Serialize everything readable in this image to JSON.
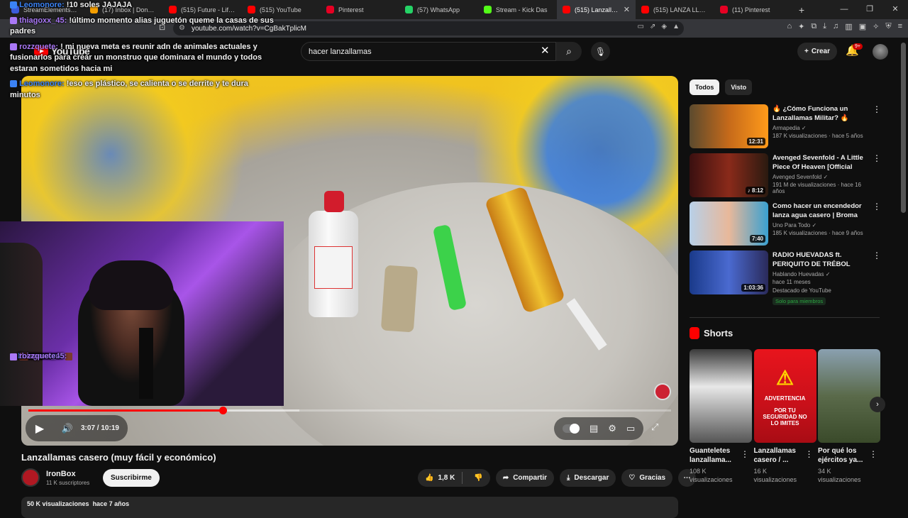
{
  "browser": {
    "tabs": [
      {
        "label": "StreamElements - My",
        "color": "#3b5bdb",
        "active": false
      },
      {
        "label": "(17) Inbox | Donoclip",
        "color": "#f59f00",
        "active": false
      },
      {
        "label": "(515) Future - Life Is",
        "color": "#ff0000",
        "active": false
      },
      {
        "label": "(515) YouTube",
        "color": "#ff0000",
        "active": false
      },
      {
        "label": "Pinterest",
        "color": "#e60023",
        "active": false
      },
      {
        "label": "(57) WhatsApp",
        "color": "#25d366",
        "active": false
      },
      {
        "label": "Stream - Kick Das",
        "color": "#53fc18",
        "active": false
      },
      {
        "label": "(515) Lanzallama",
        "color": "#ff0000",
        "active": true
      },
      {
        "label": "(515) LANZA LLAMA",
        "color": "#ff0000",
        "active": false
      },
      {
        "label": "(11) Pinterest",
        "color": "#e60023",
        "active": false
      }
    ],
    "url": "youtube.com/watch?v=CgBakTplicM"
  },
  "header": {
    "logo": "YouTube",
    "search_value": "hacer lanzallamas",
    "create_label": "Crear",
    "notif_count": "9+"
  },
  "chat": [
    {
      "user": "Leomonore:",
      "text": "",
      "user_color": "#3b83f6",
      "emote": false
    },
    {
      "user": "Leomonore:",
      "text": "!10 soles JAJAJA",
      "user_color": "#3b83f6",
      "emote": false
    },
    {
      "user": "Leomonore:",
      "text": "",
      "user_color": "#3b83f6",
      "emote": true
    },
    {
      "user": "",
      "text": "",
      "user_color": "#3b83f6",
      "emote": true
    },
    {
      "user": "Leomonore:",
      "text": "",
      "user_color": "#3b83f6",
      "emote": true
    },
    {
      "user": "Leomonore:",
      "text": "",
      "user_color": "#3b83f6",
      "emote": true
    },
    {
      "user": "thiagoxx_45:",
      "text": "!último momento alias juguetón queme la casas de sus padres",
      "user_color": "#a978f6",
      "emote": false
    },
    {
      "user": "thiagoxx_45:",
      "text": "",
      "user_color": "#a978f6",
      "emote": false
    },
    {
      "user": "rozzquete:",
      "text": "! mi nueva meta es reunir adn de animales actuales y fusionarlos para crear un monstruo que dominara el mundo y todos estaran sometidos hacia mi",
      "user_color": "#a978f6",
      "emote": false
    },
    {
      "user": "rozzquete:",
      "text": "",
      "user_color": "#a978f6",
      "emote": false
    },
    {
      "user": "Leomonore:",
      "text": "!eso es plástico, se calienta o se derrite y te dura minutos",
      "user_color": "#3b83f6",
      "emote": false
    }
  ],
  "player": {
    "current_time": "3:07",
    "duration": "10:19",
    "progress_fraction": 0.302
  },
  "video": {
    "title": "Lanzallamas casero (muy fácil y económico)",
    "channel": "IronBox",
    "subscribers": "11 K suscriptores",
    "subscribe_label": "Suscribirme",
    "likes": "1,8 K",
    "share_label": "Compartir",
    "download_label": "Descargar",
    "thanks_label": "Gracias",
    "views": "50 K visualizaciones",
    "age": "hace 7 años"
  },
  "sidebar": {
    "chips": [
      "Todos",
      "Visto"
    ],
    "recommendations": [
      {
        "title": "🔥 ¿Cómo Funciona un Lanzallamas Militar? 🔥",
        "channel": "Armapedia",
        "meta": "187 K visualizaciones · hace 5 años",
        "duration": "12:31",
        "thumb": "linear-gradient(90deg,#5b4a2e,#c66a1a 50%,#ff9a1a)",
        "featured": "",
        "members": ""
      },
      {
        "title": "Avenged Sevenfold - A Little Piece Of Heaven [Official Musi...",
        "channel": "Avenged Sevenfold",
        "meta": "191 M de visualizaciones · hace 16 años",
        "duration": "♪ 8:12",
        "thumb": "linear-gradient(90deg,#3a1010,#8a2a1a 50%,#2a1a10)",
        "featured": "",
        "members": ""
      },
      {
        "title": "Como hacer un encendedor lanza agua casero | Broma",
        "channel": "Uno Para Todo",
        "meta": "185 K visualizaciones · hace 9 años",
        "duration": "7:40",
        "thumb": "linear-gradient(90deg,#b8d0e8,#e8b89a 50%,#3aa0d0)",
        "featured": "",
        "members": ""
      },
      {
        "title": "RADIO HUEVADAS ft. PERIQUITO DE TRÉBOL CLAN",
        "channel": "Hablando Huevadas",
        "meta": "hace 11 meses",
        "duration": "1:03:36",
        "thumb": "linear-gradient(90deg,#1a3a8a,#4a6ad0 50%,#2a2a5a)",
        "featured": "Destacado de YouTube",
        "members": "Solo para miembros"
      }
    ],
    "shorts_title": "Shorts",
    "shorts": [
      {
        "title": "Guanteletes lanzallama...",
        "views": "108 K visualizaciones",
        "thumb": "linear-gradient(180deg,#3a3a3a,#e8e8e8 40%,#555)"
      },
      {
        "title": "Lanzallamas casero / ...",
        "views": "16 K visualizaciones",
        "thumb": "linear-gradient(180deg,#e8141c,#c8101a 60%,#a80c14)"
      },
      {
        "title": "Por qué los ejércitos ya...",
        "views": "34 K visualizaciones",
        "thumb": "linear-gradient(180deg,#8aa0b0,#5a6a4a 50%,#3a4a2a)"
      }
    ],
    "shorts_overlay": [
      "ADVERTENCIA",
      "POR TU SEGURIDAD NO LO IMITES"
    ]
  }
}
